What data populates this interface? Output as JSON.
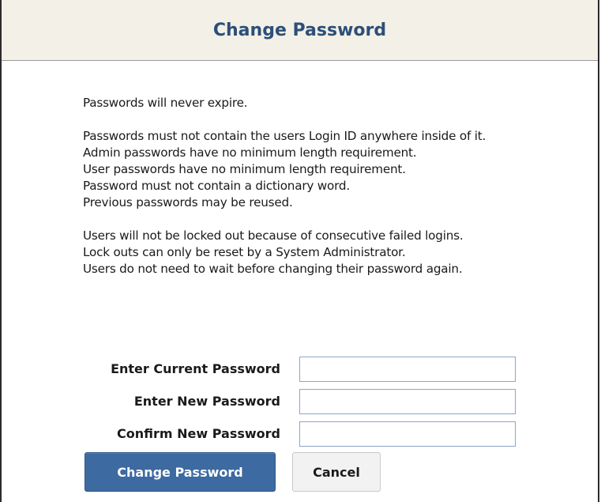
{
  "header": {
    "title": "Change Password"
  },
  "policy": {
    "groups": [
      [
        "Passwords will never expire."
      ],
      [
        "Passwords must not contain the users Login ID anywhere inside of it.",
        "Admin passwords have no minimum length requirement.",
        "User passwords have no minimum length requirement.",
        "Password must not contain a dictionary word.",
        "Previous passwords may be reused."
      ],
      [
        "Users will not be locked out because of consecutive failed logins.",
        "Lock outs can only be reset by a System Administrator.",
        "Users do not need to wait before changing their password again."
      ]
    ]
  },
  "form": {
    "current_label": "Enter Current Password",
    "current_value": "",
    "new_label": "Enter New Password",
    "new_value": "",
    "confirm_label": "Confirm New Password",
    "confirm_value": ""
  },
  "buttons": {
    "submit_label": "Change Password",
    "cancel_label": "Cancel"
  },
  "colors": {
    "header_bg": "#f3f0e7",
    "title": "#2c4f78",
    "primary_button": "#3d6aa0",
    "input_border": "#8ea6c6"
  }
}
